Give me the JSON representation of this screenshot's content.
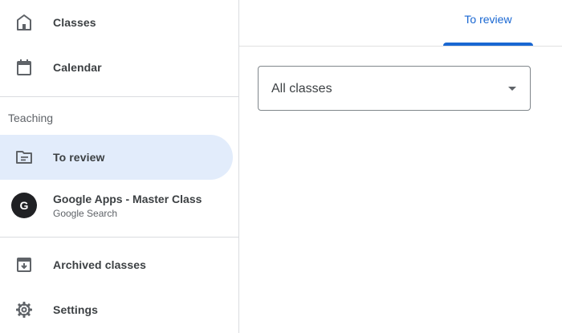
{
  "sidebar": {
    "items": [
      {
        "label": "Classes",
        "icon": "home-icon"
      },
      {
        "label": "Calendar",
        "icon": "calendar-icon"
      }
    ],
    "teaching_heading": "Teaching",
    "to_review": {
      "label": "To review",
      "icon": "folder-review-icon",
      "active": true
    },
    "class": {
      "avatar_letter": "G",
      "title": "Google Apps - Master Class",
      "subtitle": "Google Search"
    },
    "bottom_items": [
      {
        "label": "Archived classes",
        "icon": "archive-icon"
      },
      {
        "label": "Settings",
        "icon": "gear-icon"
      }
    ]
  },
  "main": {
    "tab_label": "To review",
    "class_filter": {
      "selected": "All classes"
    }
  },
  "colors": {
    "accent": "#1967d2",
    "active_bg": "#e2ecfb",
    "avatar_bg": "#202124"
  }
}
